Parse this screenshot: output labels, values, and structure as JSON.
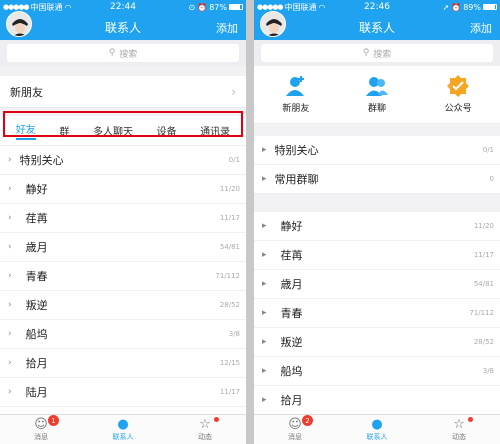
{
  "left": {
    "status": {
      "carrier": "中国联通",
      "time": "22:44",
      "battery": "87%",
      "battery_level": 0.87
    },
    "nav": {
      "title": "联系人",
      "add": "添加"
    },
    "search": {
      "placeholder": "搜索"
    },
    "new_friend": "新朋友",
    "tabs": [
      "好友",
      "群",
      "多人聊天",
      "设备",
      "通讯录"
    ],
    "special": {
      "label": "特别关心",
      "count": "0/1"
    },
    "groups": [
      {
        "name": "静好",
        "count": "11/20"
      },
      {
        "name": "荏苒",
        "count": "11/17"
      },
      {
        "name": "歳月",
        "count": "54/81"
      },
      {
        "name": "青春",
        "count": "71/112"
      },
      {
        "name": "叛逆",
        "count": "28/52"
      },
      {
        "name": "船坞",
        "count": "3/8"
      },
      {
        "name": "拾月",
        "count": "12/15"
      },
      {
        "name": "陆月",
        "count": "11/17"
      }
    ],
    "tabbar": {
      "messages": "消息",
      "messages_badge": "1",
      "contacts": "联系人",
      "dynamic": "动态"
    }
  },
  "right": {
    "status": {
      "carrier": "中国联通",
      "time": "22:46",
      "battery": "89%",
      "battery_level": 0.89
    },
    "nav": {
      "title": "联系人",
      "add": "添加"
    },
    "search": {
      "placeholder": "搜索"
    },
    "quick": [
      "新朋友",
      "群聊",
      "公众号"
    ],
    "special": {
      "label": "特别关心",
      "count": "0/1"
    },
    "common_groups": {
      "label": "常用群聊",
      "count": "0"
    },
    "groups": [
      {
        "name": "静好",
        "count": "11/20"
      },
      {
        "name": "荏苒",
        "count": "11/17"
      },
      {
        "name": "歳月",
        "count": "54/81"
      },
      {
        "name": "青春",
        "count": "71/112"
      },
      {
        "name": "叛逆",
        "count": "28/52"
      },
      {
        "name": "船坞",
        "count": "3/8"
      },
      {
        "name": "拾月",
        "count": ""
      }
    ],
    "tabbar": {
      "messages": "消息",
      "messages_badge": "2",
      "contacts": "联系人",
      "dynamic": "动态"
    }
  },
  "colors": {
    "accent": "#1fa3f0",
    "highlight_box": "#e00012",
    "badge": "#f23a2d",
    "official_icon": "#f5a623"
  }
}
